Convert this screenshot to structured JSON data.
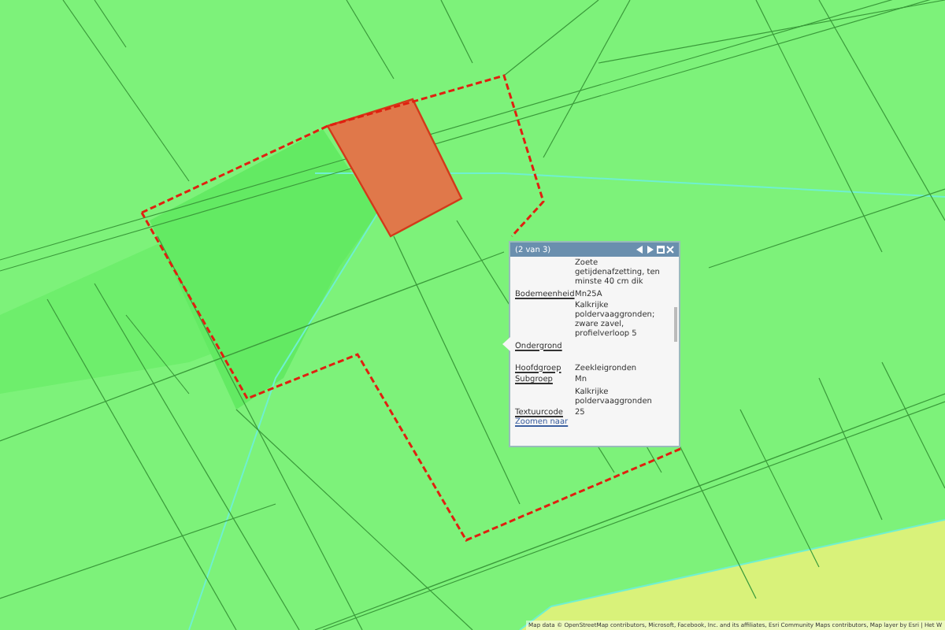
{
  "popup": {
    "title": "(2 van 3)",
    "rows": [
      {
        "label": "",
        "value": "Zoete getijdenafzetting, ten minste 40 cm dik"
      },
      {
        "label": "Bodemeenheid",
        "value": "Mn25A"
      },
      {
        "label": "",
        "value": "Kalkrijke poldervaaggronden; zware zavel, profielverloop 5"
      },
      {
        "label": "Ondergrond",
        "value": ""
      },
      {
        "label": "Hoofdgroep",
        "value": "Zeekleigronden"
      },
      {
        "label": "Subgroep",
        "value": "Mn"
      },
      {
        "label": "",
        "value": "Kalkrijke poldervaaggronden"
      },
      {
        "label": "Textuurcode",
        "value": "25"
      }
    ],
    "link": "Zoomen naar"
  },
  "attribution": "Map data © OpenStreetMap contributors, Microsoft, Facebook, Inc. and its affiliates, Esri Community Maps contributors, Map layer by Esri | Het W"
}
